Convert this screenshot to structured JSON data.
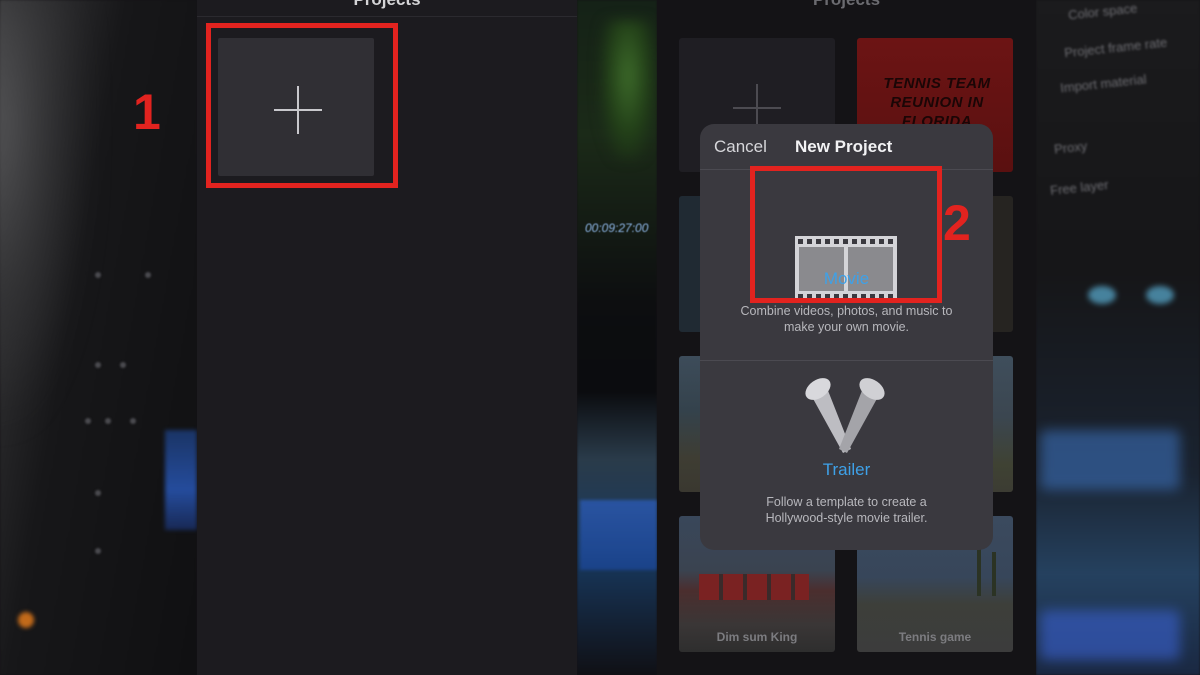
{
  "left_screen": {
    "title": "Projects",
    "step_label": "1"
  },
  "right_screen": {
    "title": "Projects",
    "step_label": "2",
    "project_thumbnails": [
      {
        "title_art": "TENNIS TEAM REUNION IN FLORIDA"
      },
      {
        "caption": "Dim sum King"
      },
      {
        "caption": "Tennis game"
      }
    ],
    "dialog": {
      "cancel_label": "Cancel",
      "title": "New Project",
      "options": [
        {
          "label": "Movie",
          "description": "Combine videos, photos, and music to make your own movie.",
          "icon": "film-strip-icon"
        },
        {
          "label": "Trailer",
          "description": "Follow a template to create a Hollywood-style movie trailer.",
          "icon": "spotlights-icon"
        }
      ]
    }
  },
  "background": {
    "timecode": "00:09:27:00",
    "side_menu": [
      "Color space",
      "Project frame rate",
      "Import material",
      "Proxy",
      "Free layer"
    ]
  },
  "colors": {
    "annotation_red": "#e2231f",
    "accent_blue": "#3ea1e8",
    "dialog_bg": "#3a393f"
  }
}
